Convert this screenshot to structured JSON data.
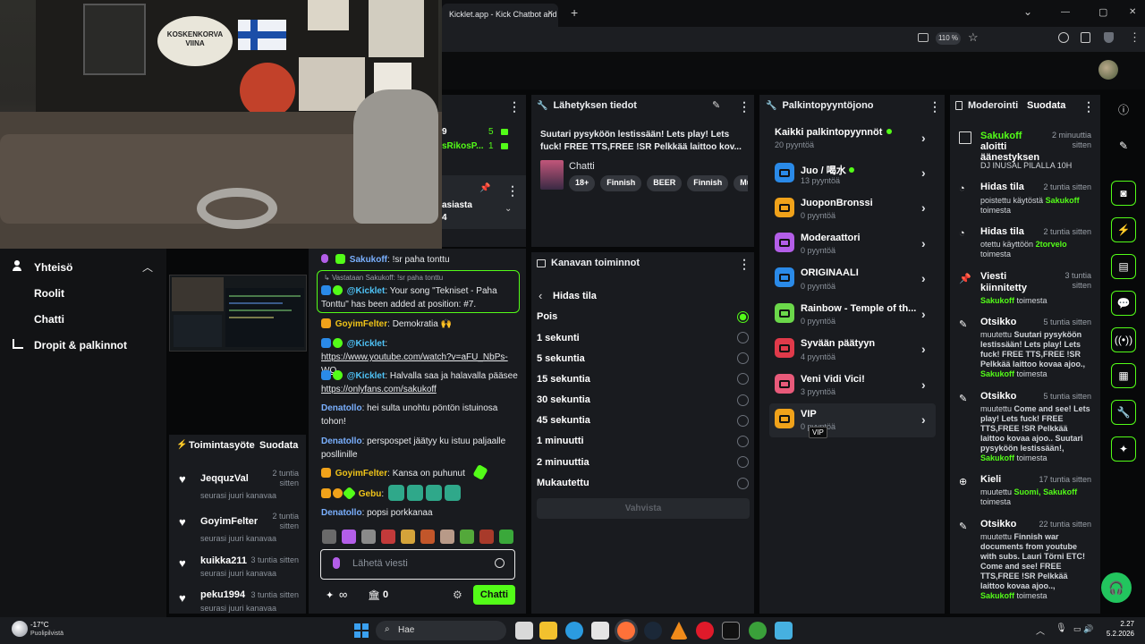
{
  "browser": {
    "tab_title": "Kicklet.app - Kick Chatbot and C",
    "zoom": "110 %",
    "close_tab": "×",
    "new_tab": "+",
    "win_min": "—",
    "win_max": "▢",
    "win_close": "✕",
    "chevron": "⌄"
  },
  "colors": {
    "kick_green": "#53fc18",
    "panel": "#191b1f",
    "bg": "#070809"
  },
  "left": {
    "section_title": "Yhteisö",
    "items": [
      "Roolit",
      "Chatti",
      "Dropit & palkinnot"
    ]
  },
  "partial_panel": {
    "num1": "9",
    "num2": "5",
    "num3": "1",
    "name": "sRikosP...",
    "text1": "asiasta",
    "text2": "4"
  },
  "activity": {
    "title": "Toimintasyöte",
    "filter": "Suodata",
    "items": [
      {
        "name": "JeqquzVal",
        "time": "2 tuntia sitten",
        "desc": "seurasi juuri kanavaa"
      },
      {
        "name": "GoyimFelter",
        "time": "2 tuntia sitten",
        "desc": "seurasi juuri kanavaa"
      },
      {
        "name": "kuikka211",
        "time": "3 tuntia sitten",
        "desc": "seurasi juuri kanavaa"
      },
      {
        "name": "peku1994",
        "time": "3 tuntia sitten",
        "desc": "seurasi juuri kanavaa"
      }
    ]
  },
  "chat": {
    "l1": {
      "user": "Sakukoff",
      "msg": ": !sr paha tonttu"
    },
    "reply": "Vastataan Sakukoff: !sr paha tonttu",
    "l2": {
      "user": "@Kicklet",
      "msg": ": Your song \"Tekniset - Paha Tonttu\" has been added at position: #7."
    },
    "l3": {
      "user": "GoyimFelter",
      "msg": ": Demokratia"
    },
    "l4": {
      "user": "@Kicklet",
      "msg": ": ",
      "link": "https://www.youtube.com/watch?v=aFU_NbPs-WQ"
    },
    "l5": {
      "user": "@Kicklet",
      "msg": ": Halvalla saa ja halavalla pääsee ",
      "link": "https://onlyfans.com/sakukoff"
    },
    "l6": {
      "user": "Denatollo",
      "msg": ": hei sulta unohtu pöntön istuinosa tohon!"
    },
    "l7": {
      "user": "Denatollo",
      "msg": ": perspospet jäätyy ku istuu paljaalle posllinille"
    },
    "l8": {
      "user": "GoyimFelter",
      "msg": ": Kansa on puhunut"
    },
    "l9": {
      "user": "Gebu",
      "msg": ":"
    },
    "l10": {
      "user": "Denatollo",
      "msg": ": popsi porkkanaa"
    },
    "input_placeholder": "Lähetä viesti",
    "points": "0",
    "send": "Chatti"
  },
  "stream_info": {
    "title": "Lähetyksen tiedot",
    "stream_title": "Suutari pysyköön lestissään! Lets play! Lets fuck! FREE TTS,FREE !SR Pelkkää laittoo kov...",
    "category": "Chatti",
    "tags": [
      "18+",
      "Finnish",
      "BEER",
      "Finnish",
      "Mu"
    ]
  },
  "channel_actions": {
    "title": "Kanavan toiminnot",
    "back": "Hidas tila",
    "options": [
      "Pois",
      "1 sekunti",
      "5 sekuntia",
      "15 sekuntia",
      "30 sekuntia",
      "45 sekuntia",
      "1 minuutti",
      "2 minuuttia",
      "Mukautettu"
    ],
    "selected": 0,
    "confirm": "Vahvista"
  },
  "rewards": {
    "title": "Palkintopyyntöjono",
    "all": {
      "name": "Kaikki palkintopyynnöt",
      "count": "20 pyyntöä"
    },
    "items": [
      {
        "name": "Juo / 喝水",
        "count": "13 pyyntöä",
        "color": "#2a8ae8",
        "dot": true
      },
      {
        "name": "JuoponBronssi",
        "count": "0 pyyntöä",
        "color": "#f0a21a",
        "dot": false
      },
      {
        "name": "Moderaattori",
        "count": "0 pyyntöä",
        "color": "#b35ee8",
        "dot": false
      },
      {
        "name": "ORIGINAALI",
        "count": "0 pyyntöä",
        "color": "#2a8ae8",
        "dot": false
      },
      {
        "name": "Rainbow - Temple of th...",
        "count": "0 pyyntöä",
        "color": "#6bd84a",
        "dot": false
      },
      {
        "name": "Syvään päätyyn",
        "count": "4 pyyntöä",
        "color": "#e03a4a",
        "dot": false
      },
      {
        "name": "Veni Vidi Vici!",
        "count": "3 pyyntöä",
        "color": "#e85a7a",
        "dot": false
      },
      {
        "name": "VIP",
        "count": "0 pyyntöä",
        "color": "#f0a21a",
        "dot": false
      }
    ],
    "tooltip": "VIP"
  },
  "moderation": {
    "title": "Moderointi",
    "filter": "Suodata",
    "items": [
      {
        "title": "Sakukoff aloitti äänestyksen",
        "time": "2 minuuttia sitten",
        "desc": "DJ INUSAL PILALLA 10H"
      },
      {
        "title": "Hidas tila",
        "time": "2 tuntia sitten",
        "desc": "poistettu käytöstä",
        "by": "Sakukoff",
        "suffix": "toimesta"
      },
      {
        "title": "Hidas tila",
        "time": "2 tuntia sitten",
        "desc": "otettu käyttöön",
        "by": "2torvelo",
        "suffix": "toimesta"
      },
      {
        "title": "Viesti kiinnitetty",
        "time": "3 tuntia sitten",
        "desc": "",
        "by": "Sakukoff",
        "suffix": "toimesta"
      },
      {
        "title": "Otsikko",
        "time": "5 tuntia sitten",
        "desc": "muutettu",
        "bold": "Suutari pysyköön lestissään! Lets play! Lets fuck! FREE TTS,FREE !SR Pelkkää laittoo kovaa ajoo.,",
        "by": "Sakukoff",
        "suffix": "toimesta"
      },
      {
        "title": "Otsikko",
        "time": "5 tuntia sitten",
        "desc": "muutettu",
        "bold": "Come and see! Lets play! Lets fuck! FREE TTS,FREE !SR Pelkkää laittoo kovaa ajoo.. Suutari pysyköön lestissään!,",
        "by": "Sakukoff",
        "suffix": "toimesta"
      },
      {
        "title": "Kieli",
        "time": "17 tuntia sitten",
        "desc": "muutettu",
        "bold": "Suomi,",
        "by": "Sakukoff",
        "suffix": "toimesta"
      },
      {
        "title": "Otsikko",
        "time": "22 tuntia sitten",
        "desc": "muutettu",
        "bold": "Finnish war documents from youtube with subs. Lauri Törni ETC! Come and see! FREE TTS,FREE !SR Pelkkää laittoo kovaa ajoo..,",
        "by": "Sakukoff",
        "suffix": "toimesta"
      }
    ]
  },
  "cam": {
    "sign": "KOSKENKORVA VIINA"
  },
  "taskbar": {
    "temp": "-17°C",
    "weather": "Puolipilvistä",
    "search": "Hae",
    "time": "2.27",
    "date": "5.2.2026"
  }
}
